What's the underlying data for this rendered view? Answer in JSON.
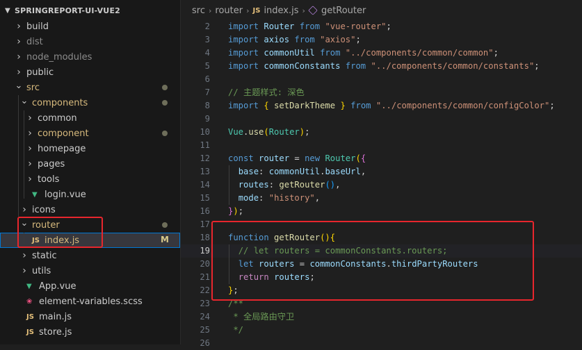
{
  "explorer": {
    "root_label": "SPRINGREPORT-UI-VUE2",
    "items": [
      {
        "label": "build",
        "kind": "folder",
        "state": "collapsed",
        "depth": 0,
        "color": "#cccccc"
      },
      {
        "label": "dist",
        "kind": "folder",
        "state": "collapsed",
        "depth": 0,
        "color": "#8c8c8c"
      },
      {
        "label": "node_modules",
        "kind": "folder",
        "state": "collapsed",
        "depth": 0,
        "color": "#8c8c8c"
      },
      {
        "label": "public",
        "kind": "folder",
        "state": "collapsed",
        "depth": 0,
        "color": "#cccccc"
      },
      {
        "label": "src",
        "kind": "folder",
        "state": "expanded",
        "depth": 0,
        "color": "#d7ba7d",
        "dot": true
      },
      {
        "label": "components",
        "kind": "folder",
        "state": "expanded",
        "depth": 1,
        "color": "#d7ba7d",
        "dot": true
      },
      {
        "label": "common",
        "kind": "folder",
        "state": "collapsed",
        "depth": 2,
        "color": "#cccccc"
      },
      {
        "label": "component",
        "kind": "folder",
        "state": "collapsed",
        "depth": 2,
        "color": "#d7ba7d",
        "dot": true
      },
      {
        "label": "homepage",
        "kind": "folder",
        "state": "collapsed",
        "depth": 2,
        "color": "#cccccc"
      },
      {
        "label": "pages",
        "kind": "folder",
        "state": "collapsed",
        "depth": 2,
        "color": "#cccccc"
      },
      {
        "label": "tools",
        "kind": "folder",
        "state": "collapsed",
        "depth": 2,
        "color": "#cccccc"
      },
      {
        "label": "login.vue",
        "kind": "vue",
        "depth": 2,
        "color": "#cccccc"
      },
      {
        "label": "icons",
        "kind": "folder",
        "state": "collapsed",
        "depth": 1,
        "color": "#cccccc"
      },
      {
        "label": "router",
        "kind": "folder",
        "state": "expanded",
        "depth": 1,
        "color": "#d7ba7d",
        "dot": true
      },
      {
        "label": "index.js",
        "kind": "js",
        "depth": 2,
        "color": "#d7ba7d",
        "selected": true,
        "flag": "M"
      },
      {
        "label": "static",
        "kind": "folder",
        "state": "collapsed",
        "depth": 1,
        "color": "#cccccc"
      },
      {
        "label": "utils",
        "kind": "folder",
        "state": "collapsed",
        "depth": 1,
        "color": "#cccccc"
      },
      {
        "label": "App.vue",
        "kind": "vue",
        "depth": 1,
        "color": "#cccccc"
      },
      {
        "label": "element-variables.scss",
        "kind": "scss",
        "depth": 1,
        "color": "#cccccc"
      },
      {
        "label": "main.js",
        "kind": "js",
        "depth": 1,
        "color": "#cccccc"
      },
      {
        "label": "store.js",
        "kind": "js",
        "depth": 1,
        "color": "#cccccc"
      }
    ]
  },
  "editor": {
    "breadcrumb": {
      "parts": [
        "src",
        "router"
      ],
      "file_badge": "JS",
      "file": "index.js",
      "symbol": "getRouter"
    },
    "current_line": 19,
    "lines": [
      {
        "n": 2,
        "indent": 0,
        "tokens": [
          [
            "kw",
            "import"
          ],
          [
            "pun",
            " "
          ],
          [
            "var",
            "Router"
          ],
          [
            "pun",
            " "
          ],
          [
            "kw",
            "from"
          ],
          [
            "pun",
            " "
          ],
          [
            "str",
            "\"vue-router\""
          ],
          [
            "pun",
            ";"
          ]
        ]
      },
      {
        "n": 3,
        "indent": 0,
        "tokens": [
          [
            "kw",
            "import"
          ],
          [
            "pun",
            " "
          ],
          [
            "var",
            "axios"
          ],
          [
            "pun",
            " "
          ],
          [
            "kw",
            "from"
          ],
          [
            "pun",
            " "
          ],
          [
            "str",
            "\"axios\""
          ],
          [
            "pun",
            ";"
          ]
        ]
      },
      {
        "n": 4,
        "indent": 0,
        "tokens": [
          [
            "kw",
            "import"
          ],
          [
            "pun",
            " "
          ],
          [
            "var",
            "commonUtil"
          ],
          [
            "pun",
            " "
          ],
          [
            "kw",
            "from"
          ],
          [
            "pun",
            " "
          ],
          [
            "str",
            "\"../components/common/common\""
          ],
          [
            "pun",
            ";"
          ]
        ]
      },
      {
        "n": 5,
        "indent": 0,
        "tokens": [
          [
            "kw",
            "import"
          ],
          [
            "pun",
            " "
          ],
          [
            "var",
            "commonConstants"
          ],
          [
            "pun",
            " "
          ],
          [
            "kw",
            "from"
          ],
          [
            "pun",
            " "
          ],
          [
            "str",
            "\"../components/common/constants\""
          ],
          [
            "pun",
            ";"
          ]
        ]
      },
      {
        "n": 6,
        "indent": 0,
        "tokens": []
      },
      {
        "n": 7,
        "indent": 0,
        "tokens": [
          [
            "cmt",
            "// 主题样式: 深色"
          ]
        ]
      },
      {
        "n": 8,
        "indent": 0,
        "tokens": [
          [
            "kw",
            "import"
          ],
          [
            "pun",
            " "
          ],
          [
            "br1",
            "{"
          ],
          [
            "pun",
            " "
          ],
          [
            "fn",
            "setDarkTheme"
          ],
          [
            "pun",
            " "
          ],
          [
            "br1",
            "}"
          ],
          [
            "pun",
            " "
          ],
          [
            "kw",
            "from"
          ],
          [
            "pun",
            " "
          ],
          [
            "str",
            "\"../components/common/configColor\""
          ],
          [
            "pun",
            ";"
          ]
        ]
      },
      {
        "n": 9,
        "indent": 0,
        "tokens": []
      },
      {
        "n": 10,
        "indent": 0,
        "tokens": [
          [
            "cls",
            "Vue"
          ],
          [
            "pun",
            "."
          ],
          [
            "fn",
            "use"
          ],
          [
            "br1",
            "("
          ],
          [
            "cls",
            "Router"
          ],
          [
            "br1",
            ")"
          ],
          [
            "pun",
            ";"
          ]
        ]
      },
      {
        "n": 11,
        "indent": 0,
        "tokens": []
      },
      {
        "n": 12,
        "indent": 0,
        "tokens": [
          [
            "kw",
            "const"
          ],
          [
            "pun",
            " "
          ],
          [
            "var",
            "router"
          ],
          [
            "pun",
            " = "
          ],
          [
            "kw",
            "new"
          ],
          [
            "pun",
            " "
          ],
          [
            "cls",
            "Router"
          ],
          [
            "br1",
            "("
          ],
          [
            "br2",
            "{"
          ]
        ]
      },
      {
        "n": 13,
        "indent": 1,
        "tokens": [
          [
            "pun",
            "  "
          ],
          [
            "var",
            "base"
          ],
          [
            "pun",
            ": "
          ],
          [
            "var",
            "commonUtil"
          ],
          [
            "pun",
            "."
          ],
          [
            "var",
            "baseUrl"
          ],
          [
            "pun",
            ","
          ]
        ]
      },
      {
        "n": 14,
        "indent": 1,
        "tokens": [
          [
            "pun",
            "  "
          ],
          [
            "var",
            "routes"
          ],
          [
            "pun",
            ": "
          ],
          [
            "fn",
            "getRouter"
          ],
          [
            "br3",
            "()"
          ],
          [
            "pun",
            ","
          ]
        ]
      },
      {
        "n": 15,
        "indent": 1,
        "tokens": [
          [
            "pun",
            "  "
          ],
          [
            "var",
            "mode"
          ],
          [
            "pun",
            ": "
          ],
          [
            "str",
            "\"history\""
          ],
          [
            "pun",
            ","
          ]
        ]
      },
      {
        "n": 16,
        "indent": 0,
        "tokens": [
          [
            "br2",
            "}"
          ],
          [
            "br1",
            ")"
          ],
          [
            "pun",
            ";"
          ]
        ]
      },
      {
        "n": 17,
        "indent": 0,
        "tokens": []
      },
      {
        "n": 18,
        "indent": 0,
        "tokens": [
          [
            "kw",
            "function"
          ],
          [
            "pun",
            " "
          ],
          [
            "fn",
            "getRouter"
          ],
          [
            "br1",
            "()"
          ],
          [
            "br1",
            "{"
          ]
        ]
      },
      {
        "n": 19,
        "indent": 1,
        "tokens": [
          [
            "pun",
            "  "
          ],
          [
            "cmt",
            "// let routers = commonConstants.routers;"
          ]
        ]
      },
      {
        "n": 20,
        "indent": 1,
        "tokens": [
          [
            "pun",
            "  "
          ],
          [
            "kw",
            "let"
          ],
          [
            "pun",
            " "
          ],
          [
            "var",
            "routers"
          ],
          [
            "pun",
            " = "
          ],
          [
            "var",
            "commonConstants"
          ],
          [
            "pun",
            "."
          ],
          [
            "var",
            "thirdPartyRouters"
          ]
        ]
      },
      {
        "n": 21,
        "indent": 1,
        "tokens": [
          [
            "pun",
            "  "
          ],
          [
            "ctl",
            "return"
          ],
          [
            "pun",
            " "
          ],
          [
            "var",
            "routers"
          ],
          [
            "pun",
            ";"
          ]
        ]
      },
      {
        "n": 22,
        "indent": 0,
        "tokens": [
          [
            "br1",
            "}"
          ],
          [
            "pun",
            ";"
          ]
        ]
      },
      {
        "n": 23,
        "indent": 0,
        "tokens": [
          [
            "cmt",
            "/**"
          ]
        ]
      },
      {
        "n": 24,
        "indent": 0,
        "tokens": [
          [
            "cmt",
            " * 全局路由守卫"
          ]
        ]
      },
      {
        "n": 25,
        "indent": 0,
        "tokens": [
          [
            "cmt",
            " */"
          ]
        ]
      },
      {
        "n": 26,
        "indent": 0,
        "tokens": []
      }
    ]
  },
  "annotation_color": "#e8262d"
}
